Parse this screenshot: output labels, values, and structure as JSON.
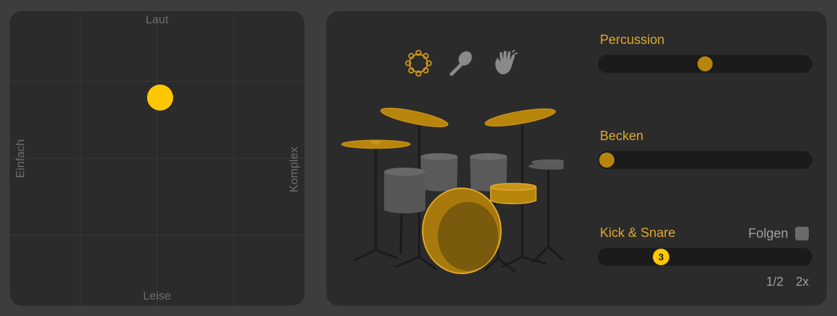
{
  "xy_pad": {
    "label_top": "Laut",
    "label_bottom": "Leise",
    "label_left": "Einfach",
    "label_right": "Komplex"
  },
  "instrument_icons": [
    "tambourine-icon",
    "shaker-icon",
    "hand-clap-icon"
  ],
  "sliders": {
    "percussion": {
      "label": "Percussion",
      "level": 0.5
    },
    "becken": {
      "label": "Becken",
      "level": 0.0
    },
    "kick_snare": {
      "label": "Kick & Snare",
      "value": "3",
      "level": 0.29
    }
  },
  "follow": {
    "label": "Folgen",
    "checked": false
  },
  "speed": {
    "half": "1/2",
    "double": "2x"
  },
  "colors": {
    "accent": "#ffc700",
    "label_gold": "#e0a92d",
    "panel": "#2b2b2b",
    "background": "#3d3d3d"
  }
}
